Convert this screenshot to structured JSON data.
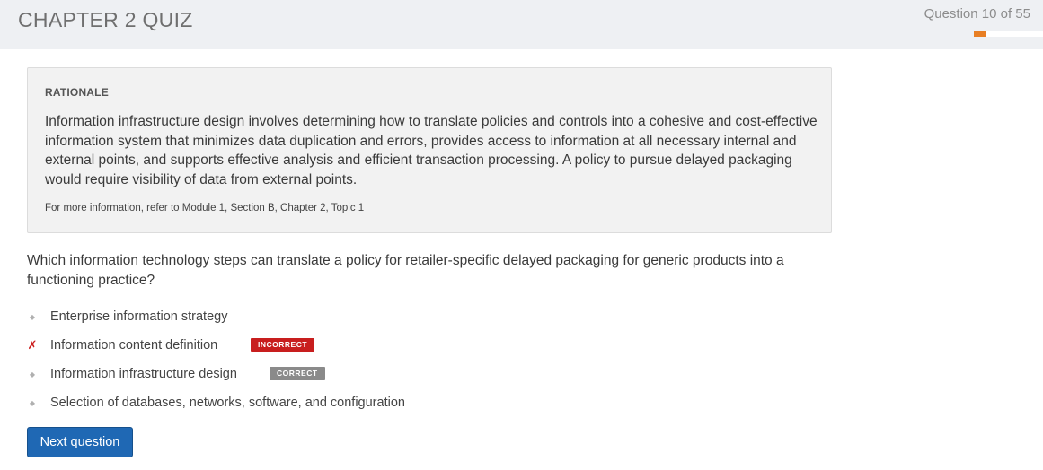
{
  "header": {
    "title": "CHAPTER 2 QUIZ",
    "counter": "Question 10 of 55",
    "progress_fraction": 0.18,
    "progress_color": "#e87f24"
  },
  "rationale": {
    "heading": "RATIONALE",
    "body": "Information infrastructure design involves determining how to translate policies and controls into a cohesive and cost-effective information system that minimizes data duplication and errors, provides access to information at all necessary internal and external points, and supports effective analysis and efficient transaction processing. A policy to pursue delayed packaging would require visibility of data from external points.",
    "reference": "For more information, refer to Module 1, Section B, Chapter 2, Topic 1"
  },
  "question": {
    "text": "Which information technology steps can translate a policy for retailer-specific delayed packaging for generic products into a functioning practice?"
  },
  "options": [
    {
      "label": "Enterprise information strategy",
      "marker_icon": "diamond-bullet-icon",
      "badge": ""
    },
    {
      "label": "Information content definition",
      "marker_icon": "x-mark-icon",
      "badge": "INCORRECT"
    },
    {
      "label": "Information infrastructure design",
      "marker_icon": "diamond-bullet-icon",
      "badge": "CORRECT"
    },
    {
      "label": "Selection of databases, networks, software, and configuration",
      "marker_icon": "diamond-bullet-icon",
      "badge": ""
    }
  ],
  "actions": {
    "next_label": "Next question"
  }
}
